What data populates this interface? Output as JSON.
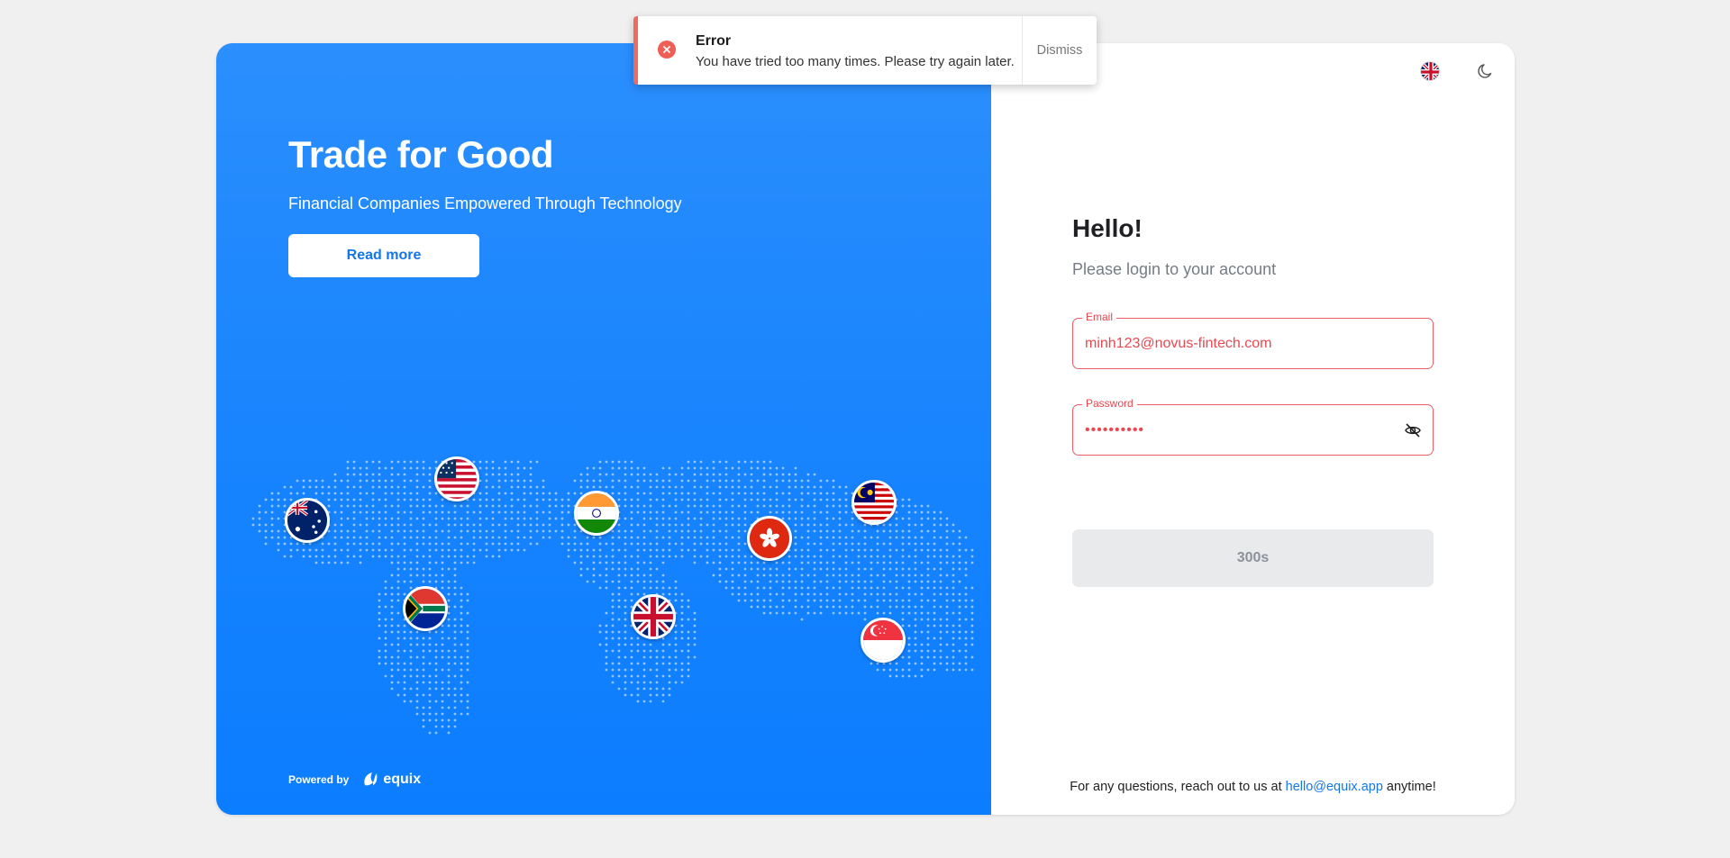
{
  "hero": {
    "title": "Trade for Good",
    "subtitle": "Financial Companies Empowered Through Technology",
    "read_more": "Read more"
  },
  "powered": {
    "label": "Powered by",
    "brand": "equix"
  },
  "flags": [
    "australia-flag",
    "usa-flag",
    "india-flag",
    "hong-kong-flag",
    "malaysia-flag",
    "south-africa-flag",
    "uk-flag",
    "singapore-flag"
  ],
  "login": {
    "greeting": "Hello!",
    "subtitle": "Please login to your account",
    "email_label": "Email",
    "email_value": "minh123@novus-fintech.com",
    "password_label": "Password",
    "password_value": "••••••••••",
    "submit_label": "300s"
  },
  "footer": {
    "prefix": "For any questions, reach out to us at",
    "email": "hello@equix.app",
    "suffix": "anytime!"
  },
  "toast": {
    "title": "Error",
    "message": "You have tried too many times. Please try again later.",
    "dismiss": "Dismiss"
  },
  "colors": {
    "primary": "#1a85fd",
    "error": "#ef5b63",
    "link": "#1677e8",
    "disabled_bg": "#e9eaec"
  }
}
